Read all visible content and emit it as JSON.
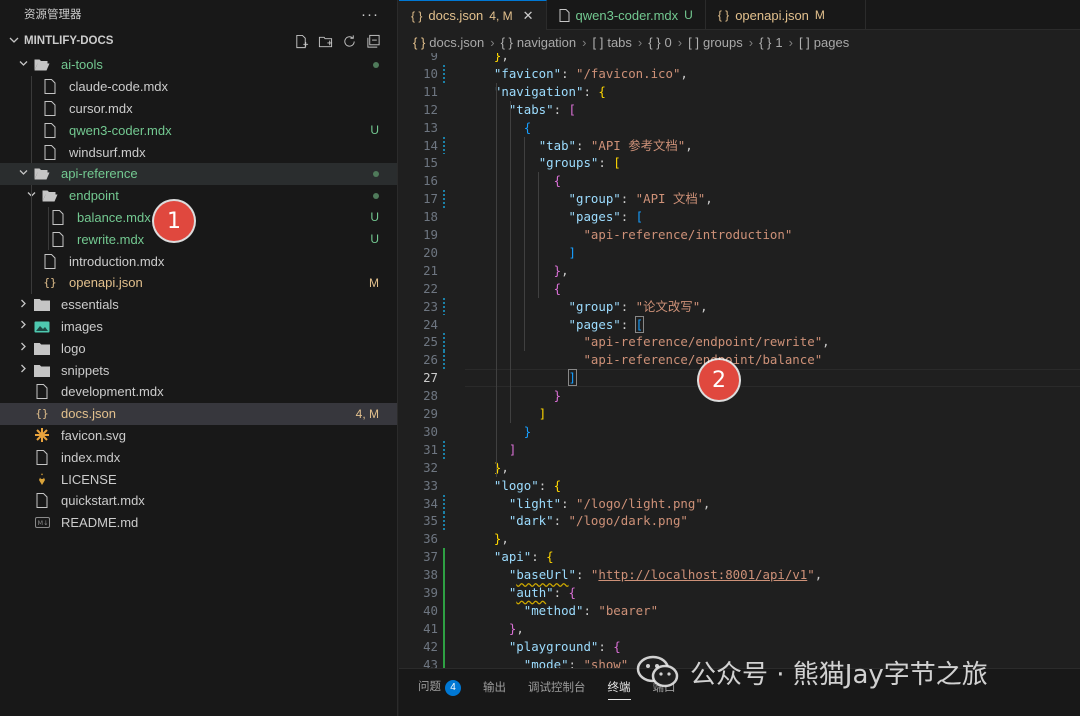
{
  "sidebar": {
    "title": "资源管理器",
    "more": "···",
    "project": "MINTLIFY-DOCS",
    "tree": [
      {
        "label": "ai-tools",
        "type": "folder-open",
        "depth": 1,
        "status": "dot",
        "color": "green"
      },
      {
        "label": "claude-code.mdx",
        "type": "file",
        "depth": 2,
        "status": "",
        "color": "default"
      },
      {
        "label": "cursor.mdx",
        "type": "file",
        "depth": 2,
        "status": "",
        "color": "default"
      },
      {
        "label": "qwen3-coder.mdx",
        "type": "file",
        "depth": 2,
        "status": "U",
        "color": "green"
      },
      {
        "label": "windsurf.mdx",
        "type": "file",
        "depth": 2,
        "status": "",
        "color": "default"
      },
      {
        "label": "api-reference",
        "type": "folder-open",
        "depth": 1,
        "status": "dot",
        "color": "green"
      },
      {
        "label": "endpoint",
        "type": "folder-open",
        "depth": 2,
        "status": "dot",
        "color": "green"
      },
      {
        "label": "balance.mdx",
        "type": "file",
        "depth": 3,
        "status": "U",
        "color": "green"
      },
      {
        "label": "rewrite.mdx",
        "type": "file",
        "depth": 3,
        "status": "U",
        "color": "green"
      },
      {
        "label": "introduction.mdx",
        "type": "file",
        "depth": 2,
        "status": "",
        "color": "default"
      },
      {
        "label": "openapi.json",
        "type": "json",
        "depth": 2,
        "status": "M",
        "color": "yellow"
      },
      {
        "label": "essentials",
        "type": "folder",
        "depth": 1,
        "status": "",
        "color": "default"
      },
      {
        "label": "images",
        "type": "folder-img",
        "depth": 1,
        "status": "",
        "color": "default"
      },
      {
        "label": "logo",
        "type": "folder",
        "depth": 1,
        "status": "",
        "color": "default"
      },
      {
        "label": "snippets",
        "type": "folder",
        "depth": 1,
        "status": "",
        "color": "default"
      },
      {
        "label": "development.mdx",
        "type": "file",
        "depth": 1,
        "status": "",
        "color": "default"
      },
      {
        "label": "docs.json",
        "type": "json",
        "depth": 1,
        "status": "4, M",
        "color": "yellow"
      },
      {
        "label": "favicon.svg",
        "type": "svg",
        "depth": 1,
        "status": "",
        "color": "default"
      },
      {
        "label": "index.mdx",
        "type": "file",
        "depth": 1,
        "status": "",
        "color": "default"
      },
      {
        "label": "LICENSE",
        "type": "license",
        "depth": 1,
        "status": "",
        "color": "default"
      },
      {
        "label": "quickstart.mdx",
        "type": "file",
        "depth": 1,
        "status": "",
        "color": "default"
      },
      {
        "label": "README.md",
        "type": "md",
        "depth": 1,
        "status": "",
        "color": "default"
      }
    ]
  },
  "tabs": [
    {
      "icon": "{ }",
      "label": "docs.json",
      "status": "4, M",
      "active": true
    },
    {
      "icon": "",
      "label": "qwen3-coder.mdx",
      "status": "U",
      "active": false
    },
    {
      "icon": "{ }",
      "label": "openapi.json",
      "status": "M",
      "active": false
    }
  ],
  "breadcrumb": [
    "docs.json",
    "navigation",
    "tabs",
    "0",
    "groups",
    "1",
    "pages"
  ],
  "breadcrumb_icons": [
    "{ }",
    "{ }",
    "[ ]",
    "{ }",
    "[ ]",
    "{ }",
    "[ ]"
  ],
  "editor": {
    "lines": [
      {
        "n": "9",
        "text": "  },"
      },
      {
        "n": "10",
        "text": "  \"favicon\": \"/favicon.ico\","
      },
      {
        "n": "11",
        "text": "  \"navigation\": {"
      },
      {
        "n": "12",
        "text": "    \"tabs\": ["
      },
      {
        "n": "13",
        "text": "      {"
      },
      {
        "n": "14",
        "text": "        \"tab\": \"API 参考文档\","
      },
      {
        "n": "15",
        "text": "        \"groups\": ["
      },
      {
        "n": "16",
        "text": "          {"
      },
      {
        "n": "17",
        "text": "            \"group\": \"API 文档\","
      },
      {
        "n": "18",
        "text": "            \"pages\": ["
      },
      {
        "n": "19",
        "text": "              \"api-reference/introduction\""
      },
      {
        "n": "20",
        "text": "            ]"
      },
      {
        "n": "21",
        "text": "          },"
      },
      {
        "n": "22",
        "text": "          {"
      },
      {
        "n": "23",
        "text": "            \"group\": \"论文改写\","
      },
      {
        "n": "24",
        "text": "            \"pages\": ["
      },
      {
        "n": "25",
        "text": "              \"api-reference/endpoint/rewrite\","
      },
      {
        "n": "26",
        "text": "              \"api-reference/endpoint/balance\""
      },
      {
        "n": "27",
        "text": "            ]"
      },
      {
        "n": "28",
        "text": "          }"
      },
      {
        "n": "29",
        "text": "        ]"
      },
      {
        "n": "30",
        "text": "      }"
      },
      {
        "n": "31",
        "text": "    ]"
      },
      {
        "n": "32",
        "text": "  },"
      },
      {
        "n": "33",
        "text": "  \"logo\": {"
      },
      {
        "n": "34",
        "text": "    \"light\": \"/logo/light.png\","
      },
      {
        "n": "35",
        "text": "    \"dark\": \"/logo/dark.png\""
      },
      {
        "n": "36",
        "text": "  },"
      },
      {
        "n": "37",
        "text": "  \"api\": {"
      },
      {
        "n": "38",
        "text": "    \"baseUrl\": \"http://localhost:8001/api/v1\","
      },
      {
        "n": "39",
        "text": "    \"auth\": {"
      },
      {
        "n": "40",
        "text": "      \"method\": \"bearer\""
      },
      {
        "n": "41",
        "text": "    },"
      },
      {
        "n": "42",
        "text": "    \"playground\": {"
      },
      {
        "n": "43",
        "text": "      \"mode\": \"show\""
      }
    ],
    "current_line": "27"
  },
  "panel": {
    "tabs": [
      "问题",
      "输出",
      "调试控制台",
      "终端",
      "端口"
    ],
    "problems_count": "4",
    "active": "终端"
  },
  "annotations": {
    "marker1": "1",
    "marker2": "2"
  },
  "watermark": "公众号 · 熊猫Jay字节之旅",
  "colors": {
    "accent": "#0078d4",
    "untracked": "#73c991",
    "modified": "#e2c08d",
    "marker": "#e0483e"
  }
}
